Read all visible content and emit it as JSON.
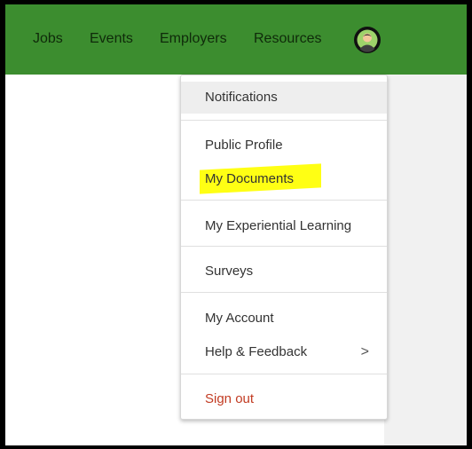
{
  "nav": {
    "jobs": "Jobs",
    "events": "Events",
    "employers": "Employers",
    "resources": "Resources"
  },
  "colors": {
    "topbar": "#3c8d2f",
    "highlight": "#ffff14",
    "signout": "#c23b22"
  },
  "menu": {
    "notifications": "Notifications",
    "public_profile": "Public Profile",
    "my_documents": "My Documents",
    "experiential_learning": "My Experiential Learning",
    "surveys": "Surveys",
    "my_account": "My Account",
    "help_feedback": "Help & Feedback",
    "help_chevron": ">",
    "sign_out": "Sign out"
  },
  "icons": {
    "avatar": "user-avatar-icon"
  }
}
